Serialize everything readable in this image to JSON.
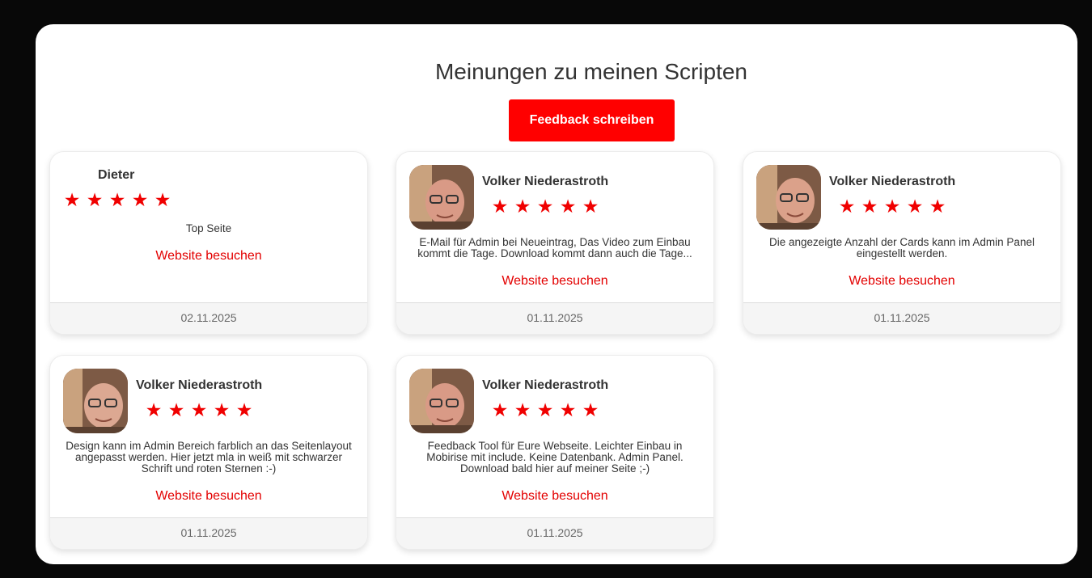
{
  "header": {
    "title": "Meinungen zu meinen Scripten",
    "feedback_button": "Feedback schreiben"
  },
  "colors": {
    "accent": "#ff0000",
    "star": "#f00000",
    "background": "#080808",
    "panel": "#ffffff",
    "footer": "#f5f5f5"
  },
  "star_glyph": "★",
  "cards": [
    {
      "author": "Dieter",
      "rating": 5,
      "has_avatar": false,
      "message": "Top Seite",
      "link_label": "Website besuchen",
      "date": "02.11.2025"
    },
    {
      "author": "Volker Niederastroth",
      "rating": 5,
      "has_avatar": true,
      "message": "E-Mail für Admin bei Neueintrag, Das Video zum Einbau kommt die Tage. Download kommt dann auch die Tage...",
      "link_label": "Website besuchen",
      "date": "01.11.2025"
    },
    {
      "author": "Volker Niederastroth",
      "rating": 5,
      "has_avatar": true,
      "message": "Die angezeigte Anzahl der Cards kann im Admin Panel eingestellt werden.",
      "link_label": "Website besuchen",
      "date": "01.11.2025"
    },
    {
      "author": "Volker Niederastroth",
      "rating": 5,
      "has_avatar": true,
      "message": "Design kann im Admin Bereich farblich an das Seitenlayout angepasst werden. Hier jetzt mla in weiß mit schwarzer Schrift und roten Sternen :-)",
      "link_label": "Website besuchen",
      "date": "01.11.2025"
    },
    {
      "author": "Volker Niederastroth",
      "rating": 5,
      "has_avatar": true,
      "message": "Feedback Tool für Eure Webseite. Leichter Einbau in Mobirise mit include. Keine Datenbank. Admin Panel. Download bald hier auf meiner Seite ;-)",
      "link_label": "Website besuchen",
      "date": "01.11.2025"
    }
  ]
}
